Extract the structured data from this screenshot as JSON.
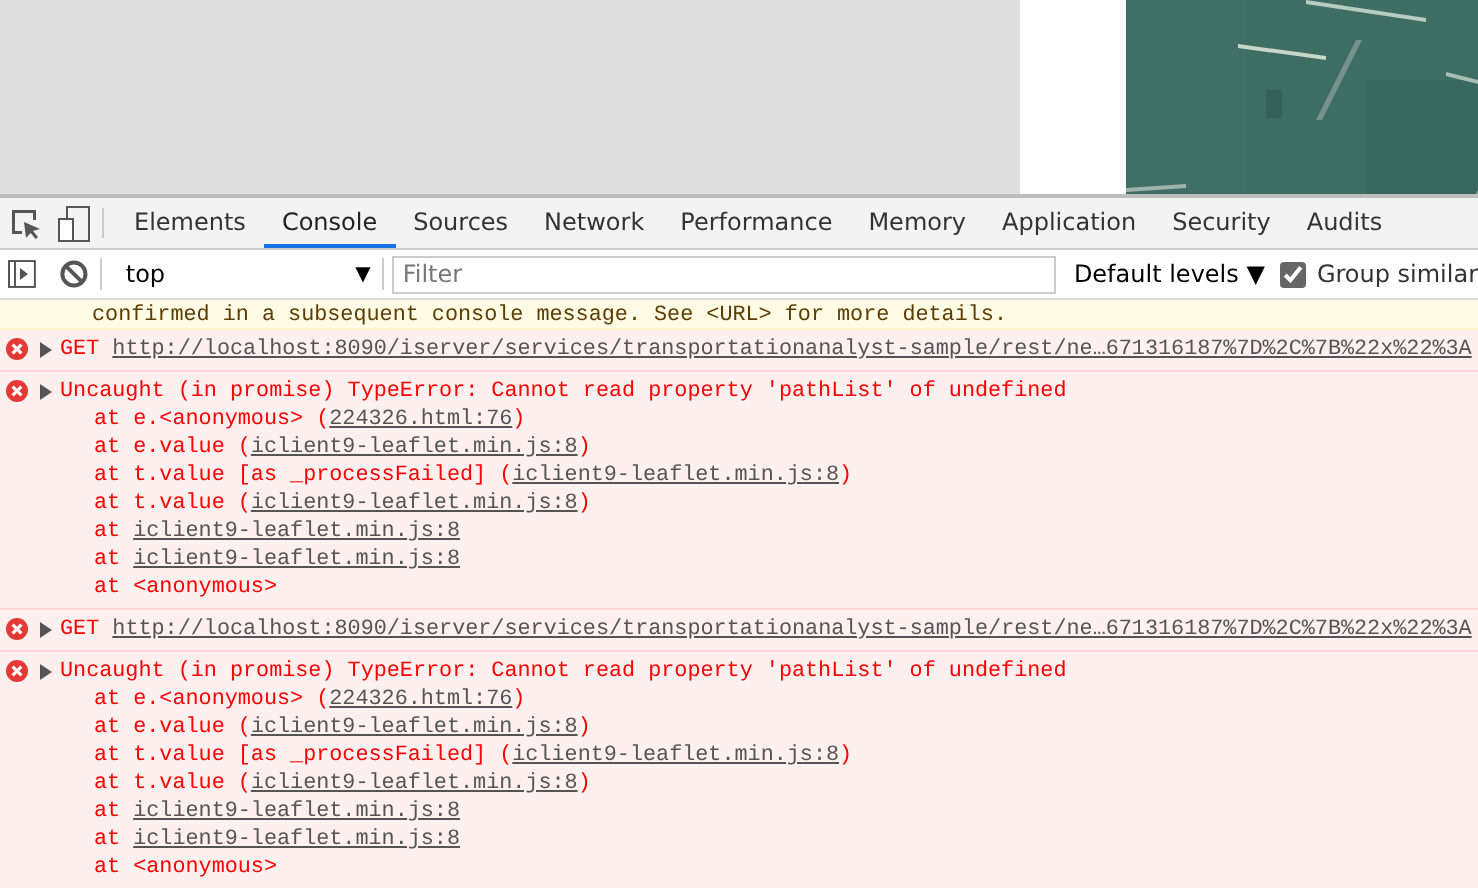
{
  "devtools": {
    "tabs": [
      {
        "label": "Elements",
        "selected": false
      },
      {
        "label": "Console",
        "selected": true
      },
      {
        "label": "Sources",
        "selected": false
      },
      {
        "label": "Network",
        "selected": false
      },
      {
        "label": "Performance",
        "selected": false
      },
      {
        "label": "Memory",
        "selected": false
      },
      {
        "label": "Application",
        "selected": false
      },
      {
        "label": "Security",
        "selected": false
      },
      {
        "label": "Audits",
        "selected": false
      }
    ],
    "toolbar": {
      "context": "top",
      "context_caret": "▼",
      "filter_placeholder": "Filter",
      "levels": "Default levels",
      "levels_caret": "▼",
      "group_similar": {
        "label": "Group similar",
        "checked": true
      }
    },
    "messages": [
      {
        "kind": "warning",
        "text": "confirmed in a subsequent console message. See <URL> for more details."
      },
      {
        "kind": "request",
        "method": "GET",
        "url": "http://localhost:8090/iserver/services/transportationanalyst-sample/rest/ne…671316187%7D%2C%7B%22x%22%3A"
      },
      {
        "kind": "exception",
        "text": "Uncaught (in promise) TypeError: Cannot read property 'pathList' of undefined",
        "stack": [
          {
            "before": "at e.<anonymous> (",
            "link": "224326.html:76",
            "after": ")"
          },
          {
            "before": "at e.value (",
            "link": "iclient9-leaflet.min.js:8",
            "after": ")"
          },
          {
            "before": "at t.value [as _processFailed] (",
            "link": "iclient9-leaflet.min.js:8",
            "after": ")"
          },
          {
            "before": "at t.value (",
            "link": "iclient9-leaflet.min.js:8",
            "after": ")"
          },
          {
            "before": "at ",
            "link": "iclient9-leaflet.min.js:8"
          },
          {
            "before": "at ",
            "link": "iclient9-leaflet.min.js:8"
          },
          {
            "before": "at <anonymous>"
          }
        ]
      },
      {
        "kind": "request",
        "method": "GET",
        "url": "http://localhost:8090/iserver/services/transportationanalyst-sample/rest/ne…671316187%7D%2C%7B%22x%22%3A"
      },
      {
        "kind": "exception",
        "text": "Uncaught (in promise) TypeError: Cannot read property 'pathList' of undefined",
        "stack": [
          {
            "before": "at e.<anonymous> (",
            "link": "224326.html:76",
            "after": ")"
          },
          {
            "before": "at e.value (",
            "link": "iclient9-leaflet.min.js:8",
            "after": ")"
          },
          {
            "before": "at t.value [as _processFailed] (",
            "link": "iclient9-leaflet.min.js:8",
            "after": ")"
          },
          {
            "before": "at t.value (",
            "link": "iclient9-leaflet.min.js:8",
            "after": ")"
          },
          {
            "before": "at ",
            "link": "iclient9-leaflet.min.js:8"
          },
          {
            "before": "at ",
            "link": "iclient9-leaflet.min.js:8"
          },
          {
            "before": "at <anonymous>"
          }
        ]
      }
    ]
  }
}
